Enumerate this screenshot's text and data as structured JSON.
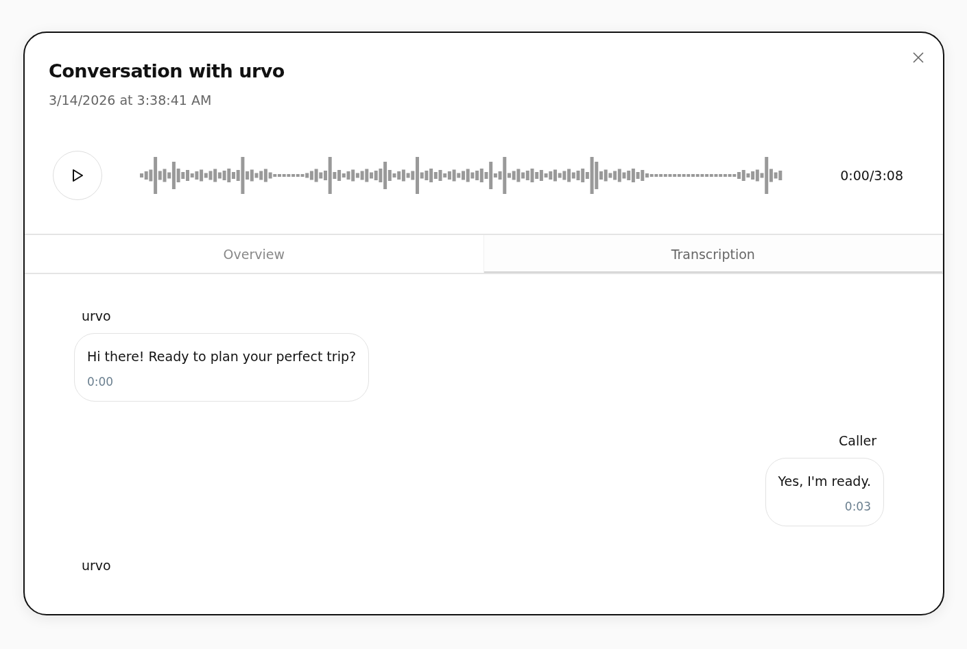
{
  "dialog": {
    "title": "Conversation with urvo",
    "timestamp": "3/14/2026 at 3:38:41 AM"
  },
  "player": {
    "time": "0:00/3:08"
  },
  "tabs": [
    {
      "label": "Overview",
      "selected": false
    },
    {
      "label": "Transcription",
      "selected": true
    }
  ],
  "messages": [
    {
      "speaker": "urvo",
      "kind": "agent",
      "text": "Hi there! Ready to plan your perfect trip?",
      "time": "0:00"
    },
    {
      "speaker": "Caller",
      "kind": "caller",
      "text": "Yes, I'm ready.",
      "time": "0:03"
    },
    {
      "speaker": "urvo",
      "kind": "agent"
    }
  ]
}
